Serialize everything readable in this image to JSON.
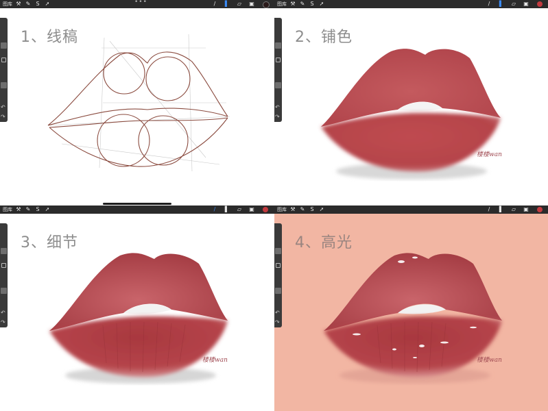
{
  "toolbar": {
    "gallery_label": "图库",
    "more_icon": "more-dots-icon"
  },
  "panels": [
    {
      "step_title": "1、线稿",
      "brush_color": "#2a1a1a"
    },
    {
      "step_title": "2、铺色",
      "brush_color": "#c23a3f",
      "signature": "楼楼wan"
    },
    {
      "step_title": "3、细节",
      "brush_color": "#c23a3f",
      "signature": "楼楼wan"
    },
    {
      "step_title": "4、高光",
      "brush_color": "#c23a3f",
      "signature": "楼楼wan"
    }
  ],
  "colors": {
    "lip": "#b5444a",
    "lip_dark": "#8e2c33",
    "highlight_bg": "#f2b6a3",
    "sketch_line": "#8a4a3e"
  }
}
